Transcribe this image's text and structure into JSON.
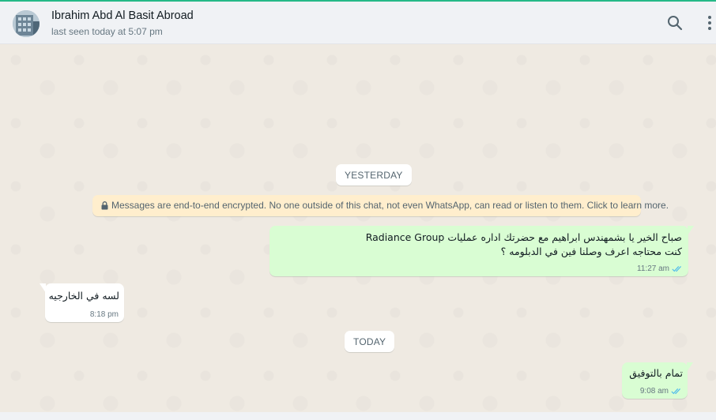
{
  "header": {
    "contact_name": "Ibrahim Abd Al Basit Abroad",
    "last_seen": "last seen today at 5:07 pm",
    "search_icon": "search-icon",
    "menu_icon": "kebab-menu-icon"
  },
  "colors": {
    "accent": "#25b987",
    "outgoing_bubble": "#d9fdd3",
    "incoming_bubble": "#ffffff",
    "encryption_notice": "#ffeecd",
    "read_ticks": "#53bdeb"
  },
  "chat": {
    "date_yesterday": "YESTERDAY",
    "encryption_notice": "Messages are end-to-end encrypted. No one outside of this chat, not even WhatsApp, can read or listen to them. Click to learn more.",
    "date_today": "TODAY",
    "messages": [
      {
        "direction": "outgoing",
        "lines": [
          "صباح الخير يا بشمهندس ابراهيم مع حضرتك اداره عمليات Radiance Group",
          "كنت محتاجه اعرف وصلنا فين في الدبلومه ؟"
        ],
        "time": "11:27 am",
        "status": "read"
      },
      {
        "direction": "incoming",
        "lines": [
          "لسه في الخارجيه"
        ],
        "time": "8:18 pm"
      },
      {
        "direction": "outgoing",
        "lines": [
          "تمام بالتوفيق"
        ],
        "time": "9:08 am",
        "status": "read"
      }
    ]
  }
}
